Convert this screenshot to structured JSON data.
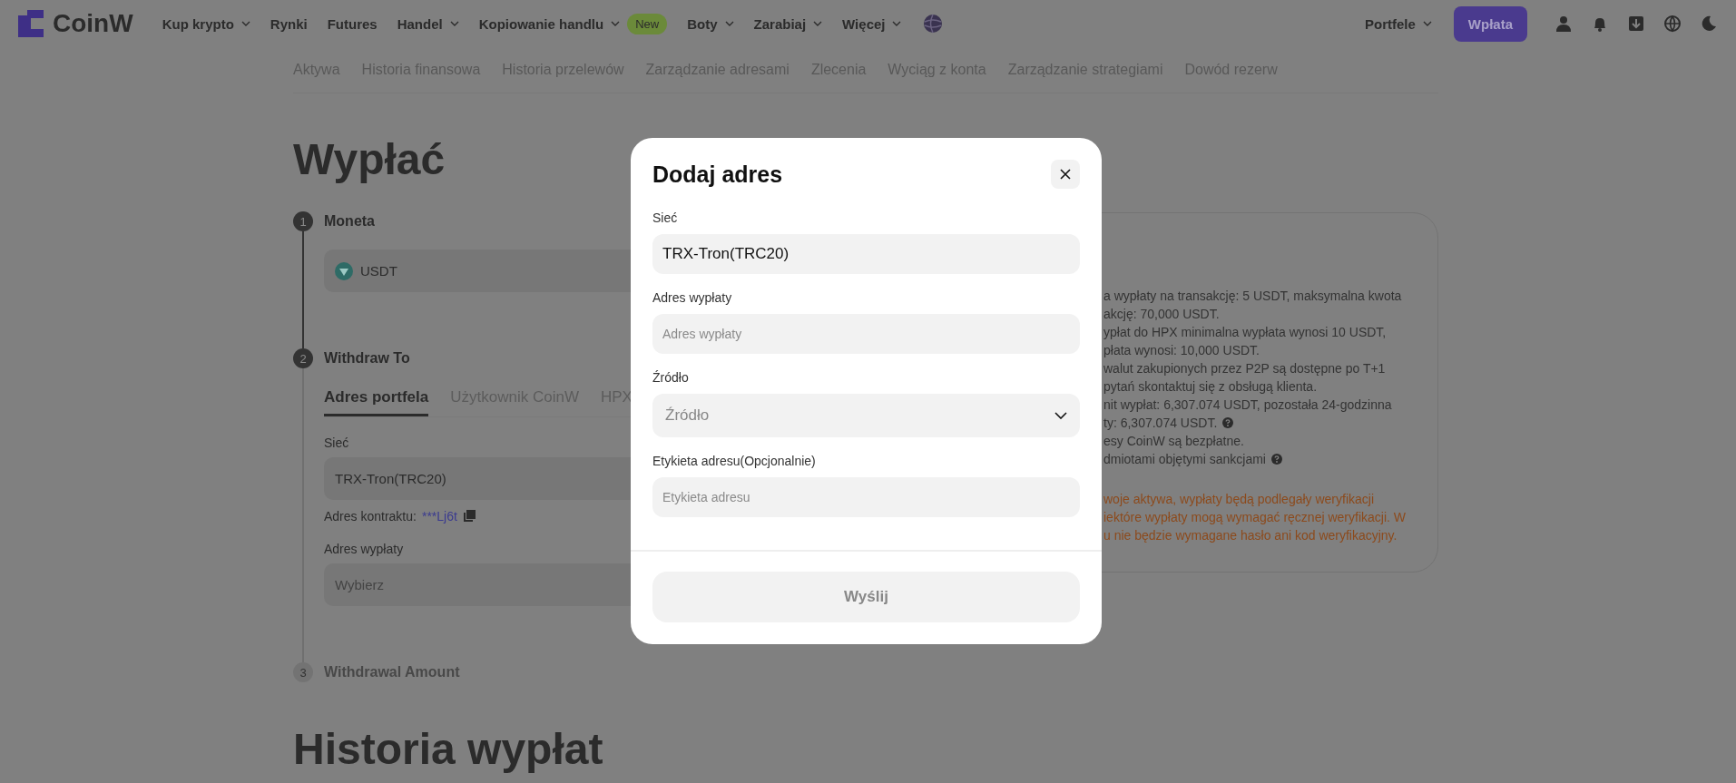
{
  "nav": {
    "logo": "CoinW",
    "items": [
      {
        "label": "Kup krypto",
        "dropdown": true
      },
      {
        "label": "Rynki",
        "dropdown": false
      },
      {
        "label": "Futures",
        "dropdown": false
      },
      {
        "label": "Handel",
        "dropdown": true
      },
      {
        "label": "Kopiowanie handlu",
        "dropdown": true,
        "badge": "New"
      },
      {
        "label": "Boty",
        "dropdown": true
      },
      {
        "label": "Zarabiaj",
        "dropdown": true
      },
      {
        "label": "Więcej",
        "dropdown": true
      }
    ],
    "wallet_menu": "Portfele",
    "deposit_button": "Wpłata"
  },
  "subnav": [
    "Aktywa",
    "Historia finansowa",
    "Historia przelewów",
    "Zarządzanie adresami",
    "Zlecenia",
    "Wyciąg z konta",
    "Zarządzanie strategiami",
    "Dowód rezerw"
  ],
  "page_title": "Wypłać",
  "steps": [
    {
      "number": "1",
      "title": "Moneta",
      "active": true
    },
    {
      "number": "2",
      "title": "Withdraw To",
      "active": true
    },
    {
      "number": "3",
      "title": "Withdrawal Amount",
      "active": false
    }
  ],
  "coin": "USDT",
  "withdraw_tabs": [
    {
      "label": "Adres portfela",
      "selected": true
    },
    {
      "label": "Użytkownik CoinW",
      "selected": false
    },
    {
      "label": "HPX",
      "selected": false
    }
  ],
  "network": {
    "label": "Sieć",
    "value": "TRX-Tron(TRC20)"
  },
  "contract": {
    "label": "Adres kontraktu:",
    "value": "***Lj6t"
  },
  "address": {
    "label": "Adres wypłaty",
    "placeholder": "Wybierz"
  },
  "notes": [
    {
      "text": "a wypłaty na transakcję: 5 USDT, maksymalna kwota",
      "kind": "info",
      "help": false
    },
    {
      "text": "akcję: 70,000 USDT.",
      "kind": "info",
      "help": false
    },
    {
      "text": "ypłat do HPX minimalna wypłata wynosi 10 USDT,",
      "kind": "info",
      "help": false
    },
    {
      "text": "płata wynosi: 10,000 USDT.",
      "kind": "info",
      "help": false
    },
    {
      "text": "walut zakupionych przez P2P są dostępne po T+1",
      "kind": "info",
      "help": false
    },
    {
      "text": "pytań skontaktuj się z obsługą klienta.",
      "kind": "info",
      "help": false
    },
    {
      "text": "nit wypłat: 6,307.074 USDT, pozostała 24-godzinna",
      "kind": "info",
      "help": false
    },
    {
      "text": "ty: 6,307.074 USDT.",
      "kind": "info",
      "help": true
    },
    {
      "text": "esy CoinW są bezpłatne.",
      "kind": "info",
      "help": false
    },
    {
      "text": "dmiotami objętymi sankcjami",
      "kind": "info",
      "help": true
    },
    {
      "text": "woje aktywa, wypłaty będą podlegały weryfikacji",
      "kind": "warning",
      "help": false
    },
    {
      "text": "iektóre wypłaty mogą wymagać ręcznej weryfikacji. W",
      "kind": "warning",
      "help": false
    },
    {
      "text": "u nie będzie wymagane hasło ani kod weryfikacyjny.",
      "kind": "warning",
      "help": false
    }
  ],
  "history_title": "Historia wypłat",
  "modal": {
    "title": "Dodaj adres",
    "fields": [
      {
        "kind": "value",
        "label": "Sieć",
        "value": "TRX-Tron(TRC20)"
      },
      {
        "kind": "input",
        "label": "Adres wypłaty",
        "placeholder": "Adres wypłaty"
      },
      {
        "kind": "select",
        "label": "Źródło",
        "placeholder": "Źródło"
      },
      {
        "kind": "input",
        "label": "Etykieta adresu(Opcjonalnie)",
        "placeholder": "Etykieta adresu"
      }
    ],
    "submit": {
      "label": "Wyślij",
      "disabled": true
    }
  }
}
